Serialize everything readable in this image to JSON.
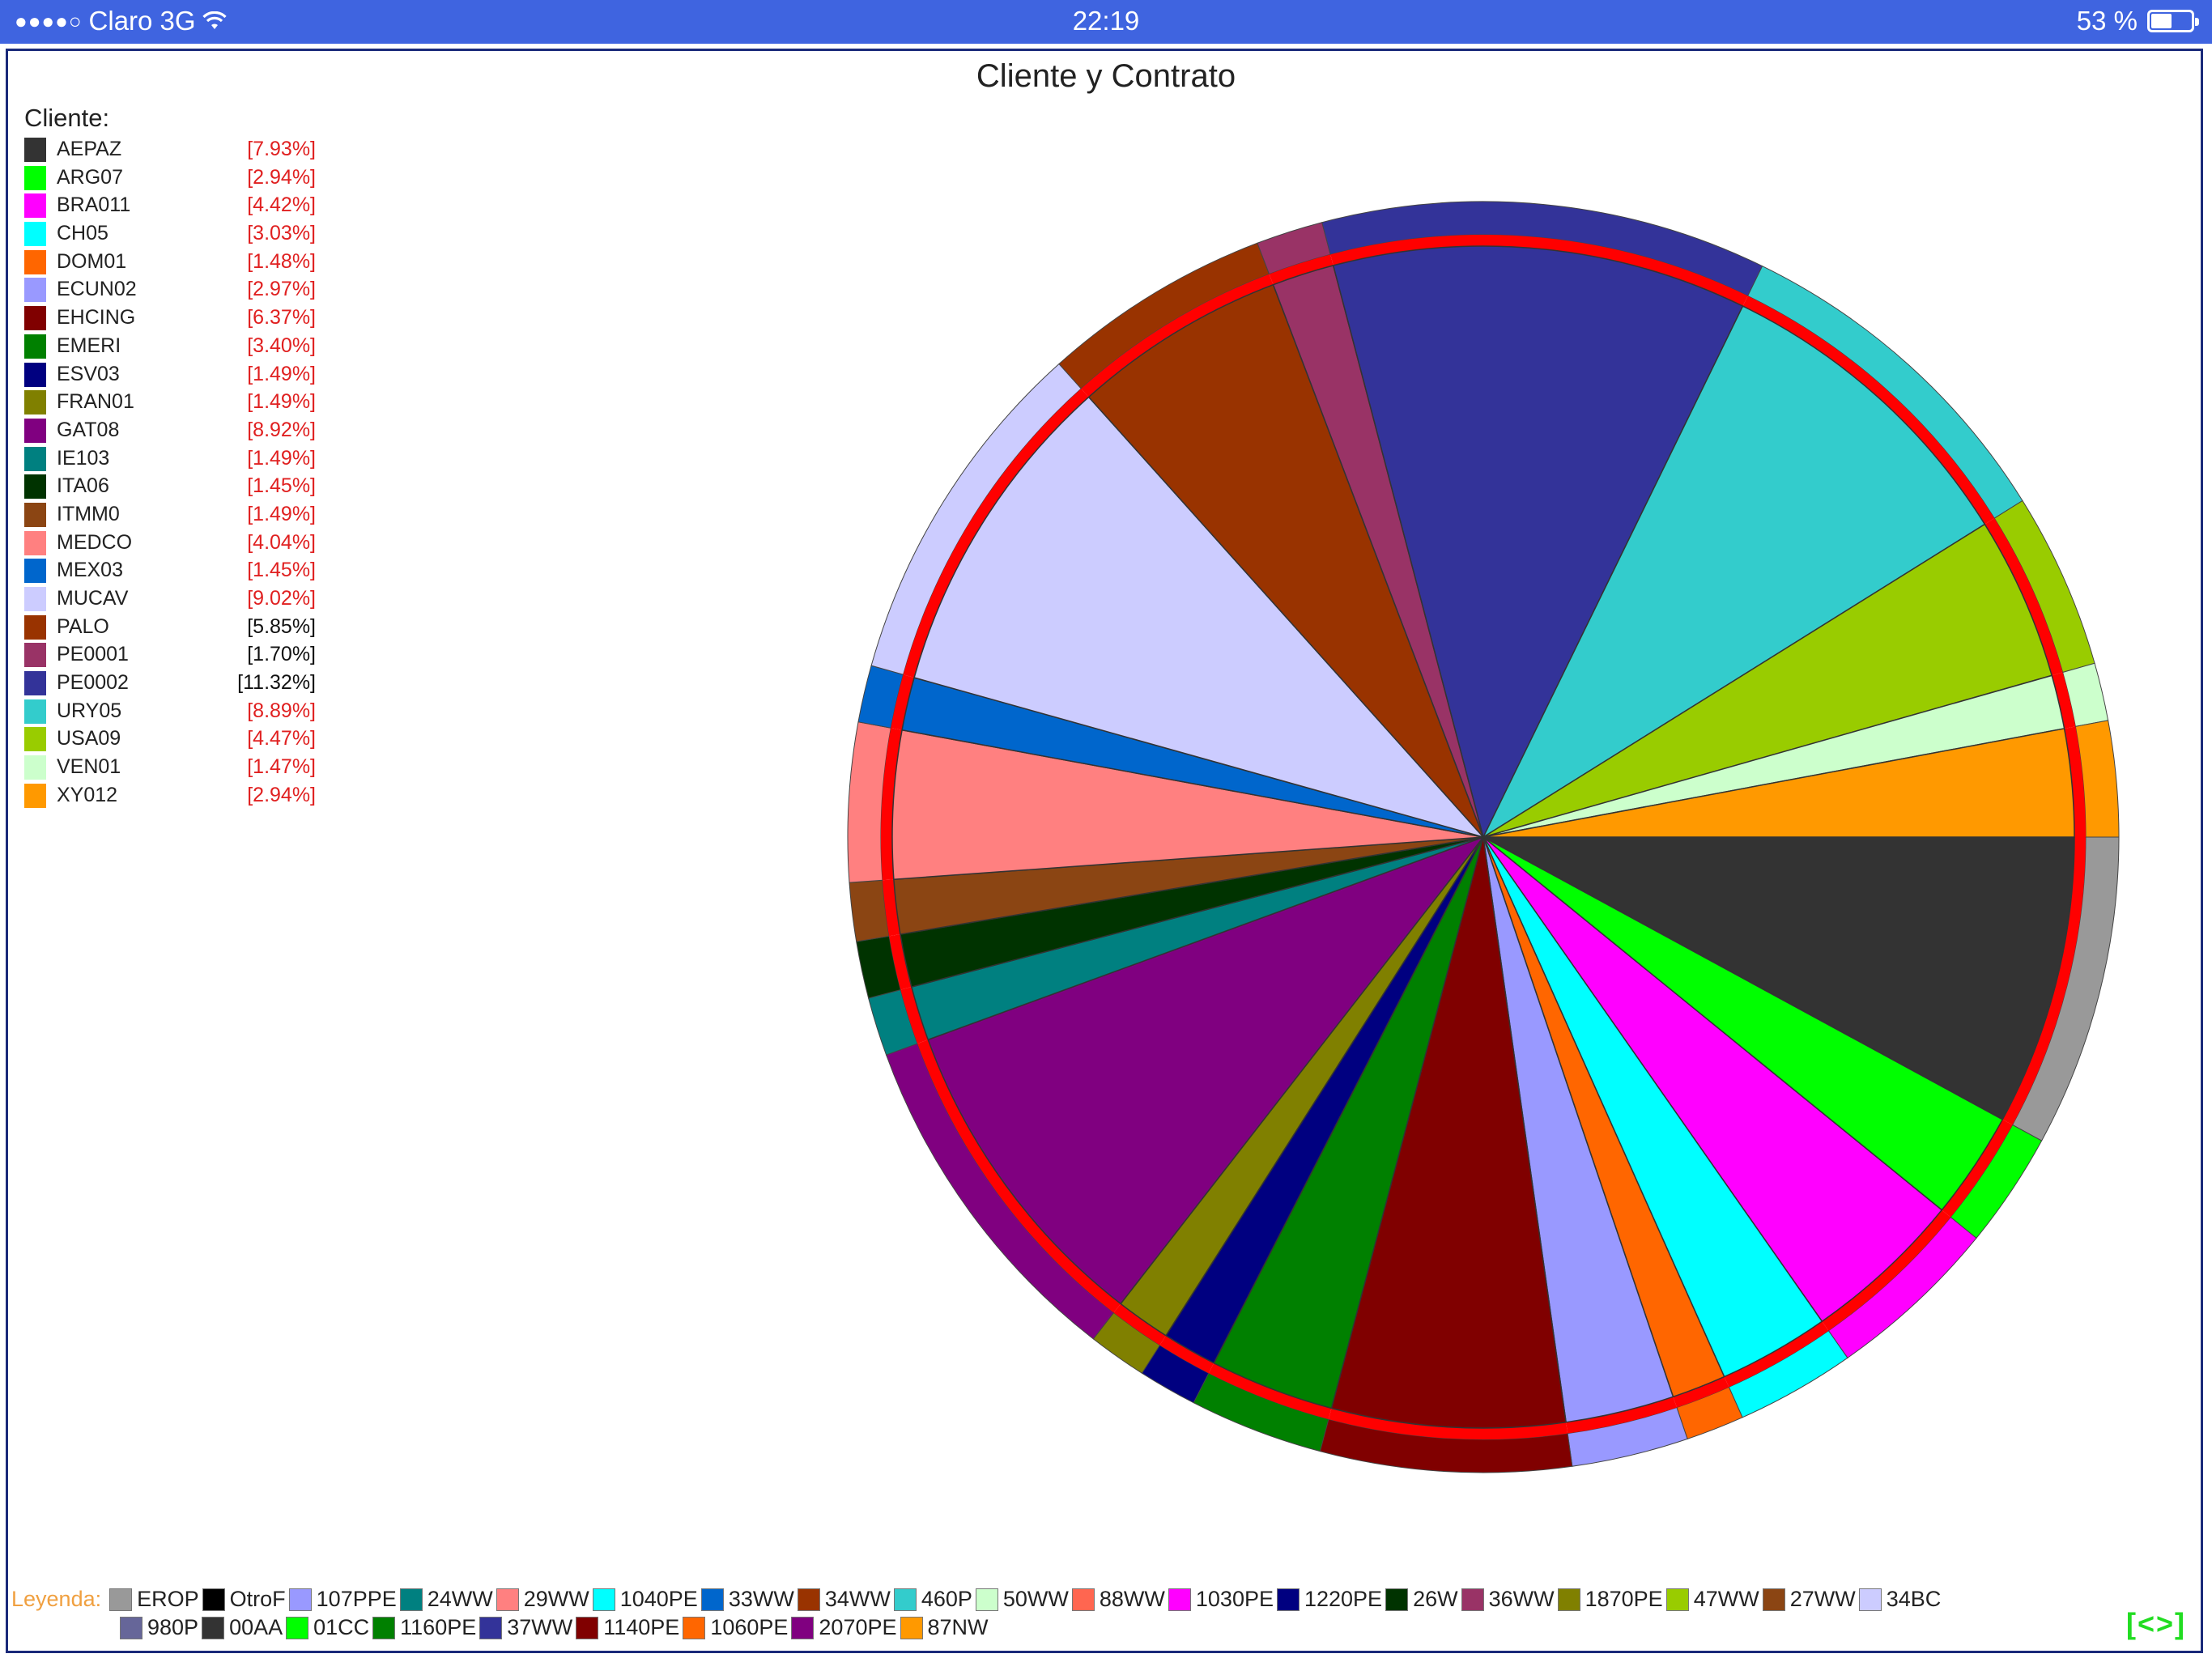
{
  "status_bar": {
    "signal": "●●●●○",
    "carrier": "Claro 3G",
    "wifi_icon": "wifi-icon",
    "time": "22:19",
    "battery_text": "53 %",
    "battery_level": 0.53
  },
  "chart_data": {
    "type": "pie",
    "title": "Cliente y Contrato",
    "legend_title": "Cliente:",
    "slices": [
      {
        "label": "AEPAZ",
        "percent_label": "[7.93%]",
        "value": 7.93,
        "color": "#333333",
        "pct_color": "#e02020"
      },
      {
        "label": "ARG07",
        "percent_label": "[2.94%]",
        "value": 2.94,
        "color": "#00ff00",
        "pct_color": "#e02020"
      },
      {
        "label": "BRA011",
        "percent_label": "[4.42%]",
        "value": 4.42,
        "color": "#ff00ff",
        "pct_color": "#e02020"
      },
      {
        "label": "CH05",
        "percent_label": "[3.03%]",
        "value": 3.03,
        "color": "#00ffff",
        "pct_color": "#e02020"
      },
      {
        "label": "DOM01",
        "percent_label": "[1.48%]",
        "value": 1.48,
        "color": "#ff6600",
        "pct_color": "#e02020"
      },
      {
        "label": "ECUN02",
        "percent_label": "[2.97%]",
        "value": 2.97,
        "color": "#9999ff",
        "pct_color": "#e02020"
      },
      {
        "label": "EHCING",
        "percent_label": "[6.37%]",
        "value": 6.37,
        "color": "#800000",
        "pct_color": "#e02020"
      },
      {
        "label": "EMERI",
        "percent_label": "[3.40%]",
        "value": 3.4,
        "color": "#008000",
        "pct_color": "#e02020"
      },
      {
        "label": "ESV03",
        "percent_label": "[1.49%]",
        "value": 1.49,
        "color": "#000080",
        "pct_color": "#e02020"
      },
      {
        "label": "FRAN01",
        "percent_label": "[1.49%]",
        "value": 1.49,
        "color": "#808000",
        "pct_color": "#e02020"
      },
      {
        "label": "GAT08",
        "percent_label": "[8.92%]",
        "value": 8.92,
        "color": "#800080",
        "pct_color": "#e02020"
      },
      {
        "label": "IE103",
        "percent_label": "[1.49%]",
        "value": 1.49,
        "color": "#008080",
        "pct_color": "#e02020"
      },
      {
        "label": "ITA06",
        "percent_label": "[1.45%]",
        "value": 1.45,
        "color": "#003300",
        "pct_color": "#e02020"
      },
      {
        "label": "ITMM0",
        "percent_label": "[1.49%]",
        "value": 1.49,
        "color": "#8b4513",
        "pct_color": "#e02020"
      },
      {
        "label": "MEDCO",
        "percent_label": "[4.04%]",
        "value": 4.04,
        "color": "#ff8080",
        "pct_color": "#e02020"
      },
      {
        "label": "MEX03",
        "percent_label": "[1.45%]",
        "value": 1.45,
        "color": "#0066cc",
        "pct_color": "#e02020"
      },
      {
        "label": "MUCAV",
        "percent_label": "[9.02%]",
        "value": 9.02,
        "color": "#ccccff",
        "pct_color": "#e02020"
      },
      {
        "label": "PALO",
        "percent_label": "[5.85%]",
        "value": 5.85,
        "color": "#993300",
        "pct_color": "#111111"
      },
      {
        "label": "PE0001",
        "percent_label": "[1.70%]",
        "value": 1.7,
        "color": "#993366",
        "pct_color": "#111111"
      },
      {
        "label": "PE0002",
        "percent_label": "[11.32%]",
        "value": 11.32,
        "color": "#333399",
        "pct_color": "#111111"
      },
      {
        "label": "URY05",
        "percent_label": "[8.89%]",
        "value": 8.89,
        "color": "#33cccc",
        "pct_color": "#e02020"
      },
      {
        "label": "USA09",
        "percent_label": "[4.47%]",
        "value": 4.47,
        "color": "#99cc00",
        "pct_color": "#e02020"
      },
      {
        "label": "VEN01",
        "percent_label": "[1.47%]",
        "value": 1.47,
        "color": "#ccffcc",
        "pct_color": "#e02020"
      },
      {
        "label": "XY012",
        "percent_label": "[2.94%]",
        "value": 2.94,
        "color": "#ff9900",
        "pct_color": "#e02020"
      }
    ],
    "outer_ring_colors": {
      "AEPAZ": "#999999",
      "ARG07": "#00ff00",
      "BRA011": "#ff00ff",
      "CH05": "#00ffff",
      "DOM01": "#ff6600",
      "ECUN02": "#9999ff",
      "EHCING": "#800000",
      "EMERI": "#008000",
      "ESV03": "#000080",
      "FRAN01": "#808000",
      "GAT08": "#800080",
      "IE103": "#008080",
      "ITA06": "#003300",
      "ITMM0": "#8b4513",
      "MEDCO": "#ff8080",
      "MEX03": "#0066cc",
      "MUCAV": "#ccccff",
      "PALO": "#993300",
      "PE0001": "#993366",
      "PE0002": "#333399",
      "URY05": "#33cccc",
      "USA09": "#99cc00",
      "VEN01": "#ccffcc",
      "XY012": "#ff9900"
    },
    "inner_ring_color": "#ff0000",
    "legend_placement": "left",
    "contract_legend": {
      "label": "Leyenda:",
      "items": [
        {
          "label": "EROP",
          "color": "#999999"
        },
        {
          "label": "OtroF",
          "color": "#000000"
        },
        {
          "label": "107PPE",
          "color": "#9999ff"
        },
        {
          "label": "24WW",
          "color": "#008080"
        },
        {
          "label": "29WW",
          "color": "#ff8080"
        },
        {
          "label": "1040PE",
          "color": "#00ffff"
        },
        {
          "label": "33WW",
          "color": "#0066cc"
        },
        {
          "label": "34WW",
          "color": "#993300"
        },
        {
          "label": "460P",
          "color": "#33cccc"
        },
        {
          "label": "50WW",
          "color": "#ccffcc"
        },
        {
          "label": "88WW",
          "color": "#ff6650"
        },
        {
          "label": "1030PE",
          "color": "#ff00ff"
        },
        {
          "label": "1220PE",
          "color": "#000080"
        },
        {
          "label": "26W",
          "color": "#003300"
        },
        {
          "label": "36WW",
          "color": "#993366"
        },
        {
          "label": "1870PE",
          "color": "#808000"
        },
        {
          "label": "47WW",
          "color": "#99cc00"
        },
        {
          "label": "27WW",
          "color": "#8b4513"
        },
        {
          "label": "34BC",
          "color": "#ccccff"
        },
        {
          "label": "980P",
          "color": "#666699"
        },
        {
          "label": "00AA",
          "color": "#333333"
        },
        {
          "label": "01CC",
          "color": "#00ff00"
        },
        {
          "label": "1160PE",
          "color": "#008000"
        },
        {
          "label": "37WW",
          "color": "#333399"
        },
        {
          "label": "1140PE",
          "color": "#800000"
        },
        {
          "label": "1060PE",
          "color": "#ff6600"
        },
        {
          "label": "2070PE",
          "color": "#800080"
        },
        {
          "label": "87NW",
          "color": "#ff9900"
        }
      ]
    }
  },
  "nav_toggle_label": "[<>]"
}
